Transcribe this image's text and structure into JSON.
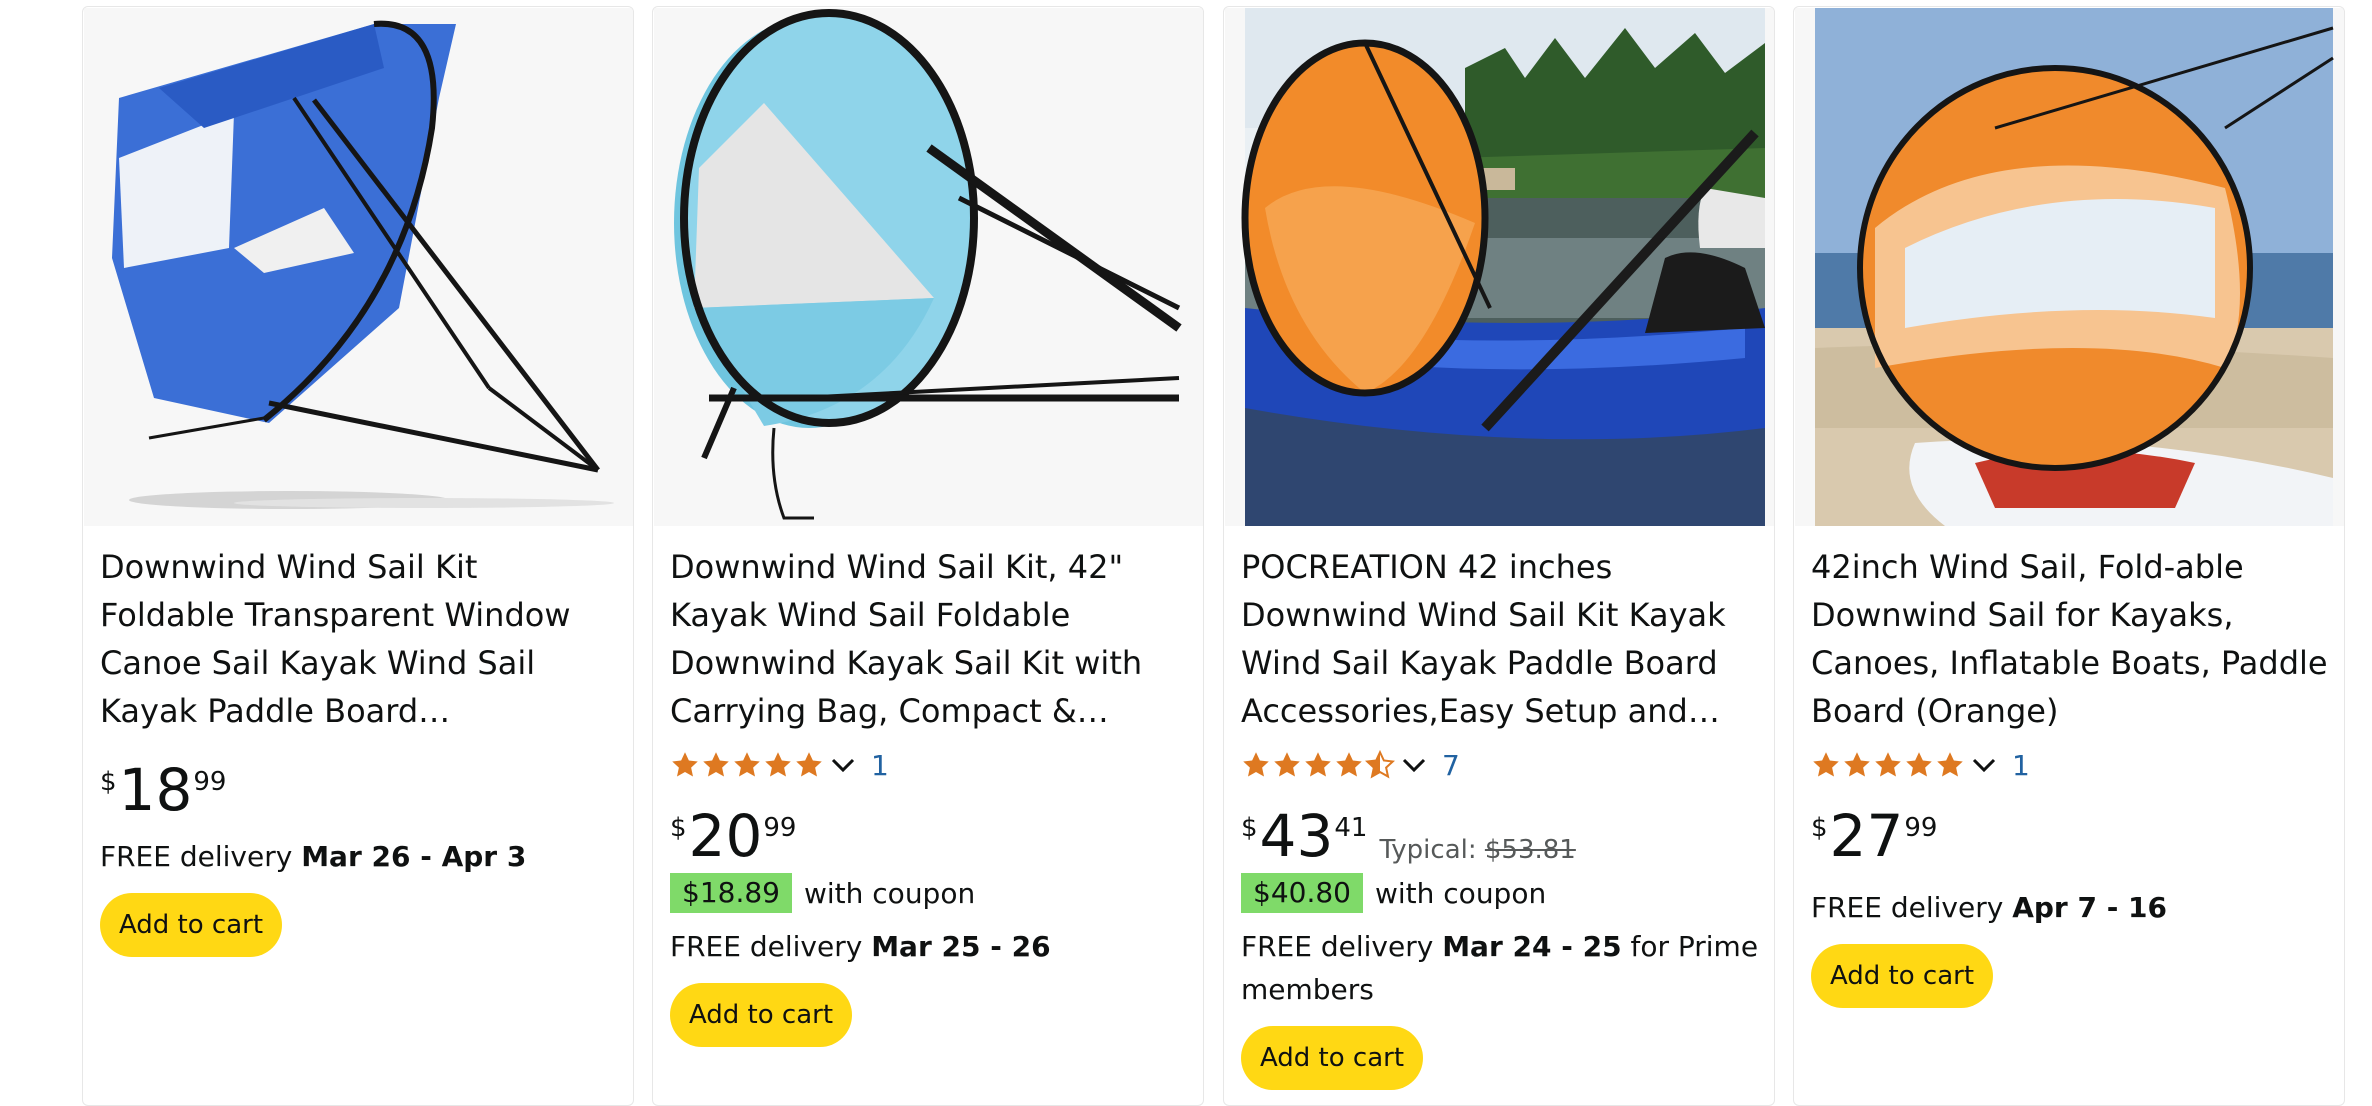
{
  "colors": {
    "button_yellow": "#ffd814",
    "coupon_green": "#7fda69",
    "star_orange": "#de7921",
    "link_blue": "#2162a1"
  },
  "products": [
    {
      "title": "Downwind Wind Sail Kit Foldable Transparent Window Canoe Sail Kayak Wind Sail Kayak Paddle Board Accessories,Easy Setup & Deploys",
      "image_alt": "Blue kayak wind sail",
      "price": {
        "currency": "$",
        "whole": "18",
        "fraction": "99"
      },
      "delivery": {
        "prefix": "FREE delivery ",
        "dates": "Mar 26 - Apr 3",
        "suffix": ""
      },
      "button_label": "Add to cart"
    },
    {
      "title": "Downwind Wind Sail Kit, 42\" Kayak Wind Sail Foldable Downwind Kayak Sail Kit with Carrying Bag, Compact & Portable, Durable Kayak Accessories",
      "image_alt": "Light blue kayak wind sail",
      "rating": {
        "stars": 5,
        "count": "1"
      },
      "price": {
        "currency": "$",
        "whole": "20",
        "fraction": "99"
      },
      "coupon": {
        "price": "$18.89",
        "text": "with coupon"
      },
      "delivery": {
        "prefix": "FREE delivery ",
        "dates": "Mar 25 - 26",
        "suffix": ""
      },
      "button_label": "Add to cart"
    },
    {
      "title": "POCREATION 42 inches Downwind Wind Sail Kit Kayak Wind Sail Kayak Paddle Board Accessories,Easy Setup and Deploys Compact",
      "image_alt": "Orange sail on a kayak on a lake",
      "rating": {
        "stars": 4.5,
        "count": "7"
      },
      "price": {
        "currency": "$",
        "whole": "43",
        "fraction": "41",
        "typical_label": "Typical: ",
        "typical_price": "$53.81"
      },
      "coupon": {
        "price": "$40.80",
        "text": "with coupon"
      },
      "delivery": {
        "prefix": "FREE delivery ",
        "dates": "Mar 24 - 25",
        "suffix": " for Prime members"
      },
      "button_label": "Add to cart"
    },
    {
      "title": "42inch Wind Sail, Fold-able Downwind Sail for Kayaks, Canoes, Inflatable Boats, Paddle Board (Orange)",
      "image_alt": "Orange sail on a paddle board at the beach",
      "rating": {
        "stars": 5,
        "count": "1"
      },
      "price": {
        "currency": "$",
        "whole": "27",
        "fraction": "99"
      },
      "delivery": {
        "prefix": "FREE delivery ",
        "dates": "Apr 7 - 16",
        "suffix": ""
      },
      "button_label": "Add to cart"
    }
  ]
}
